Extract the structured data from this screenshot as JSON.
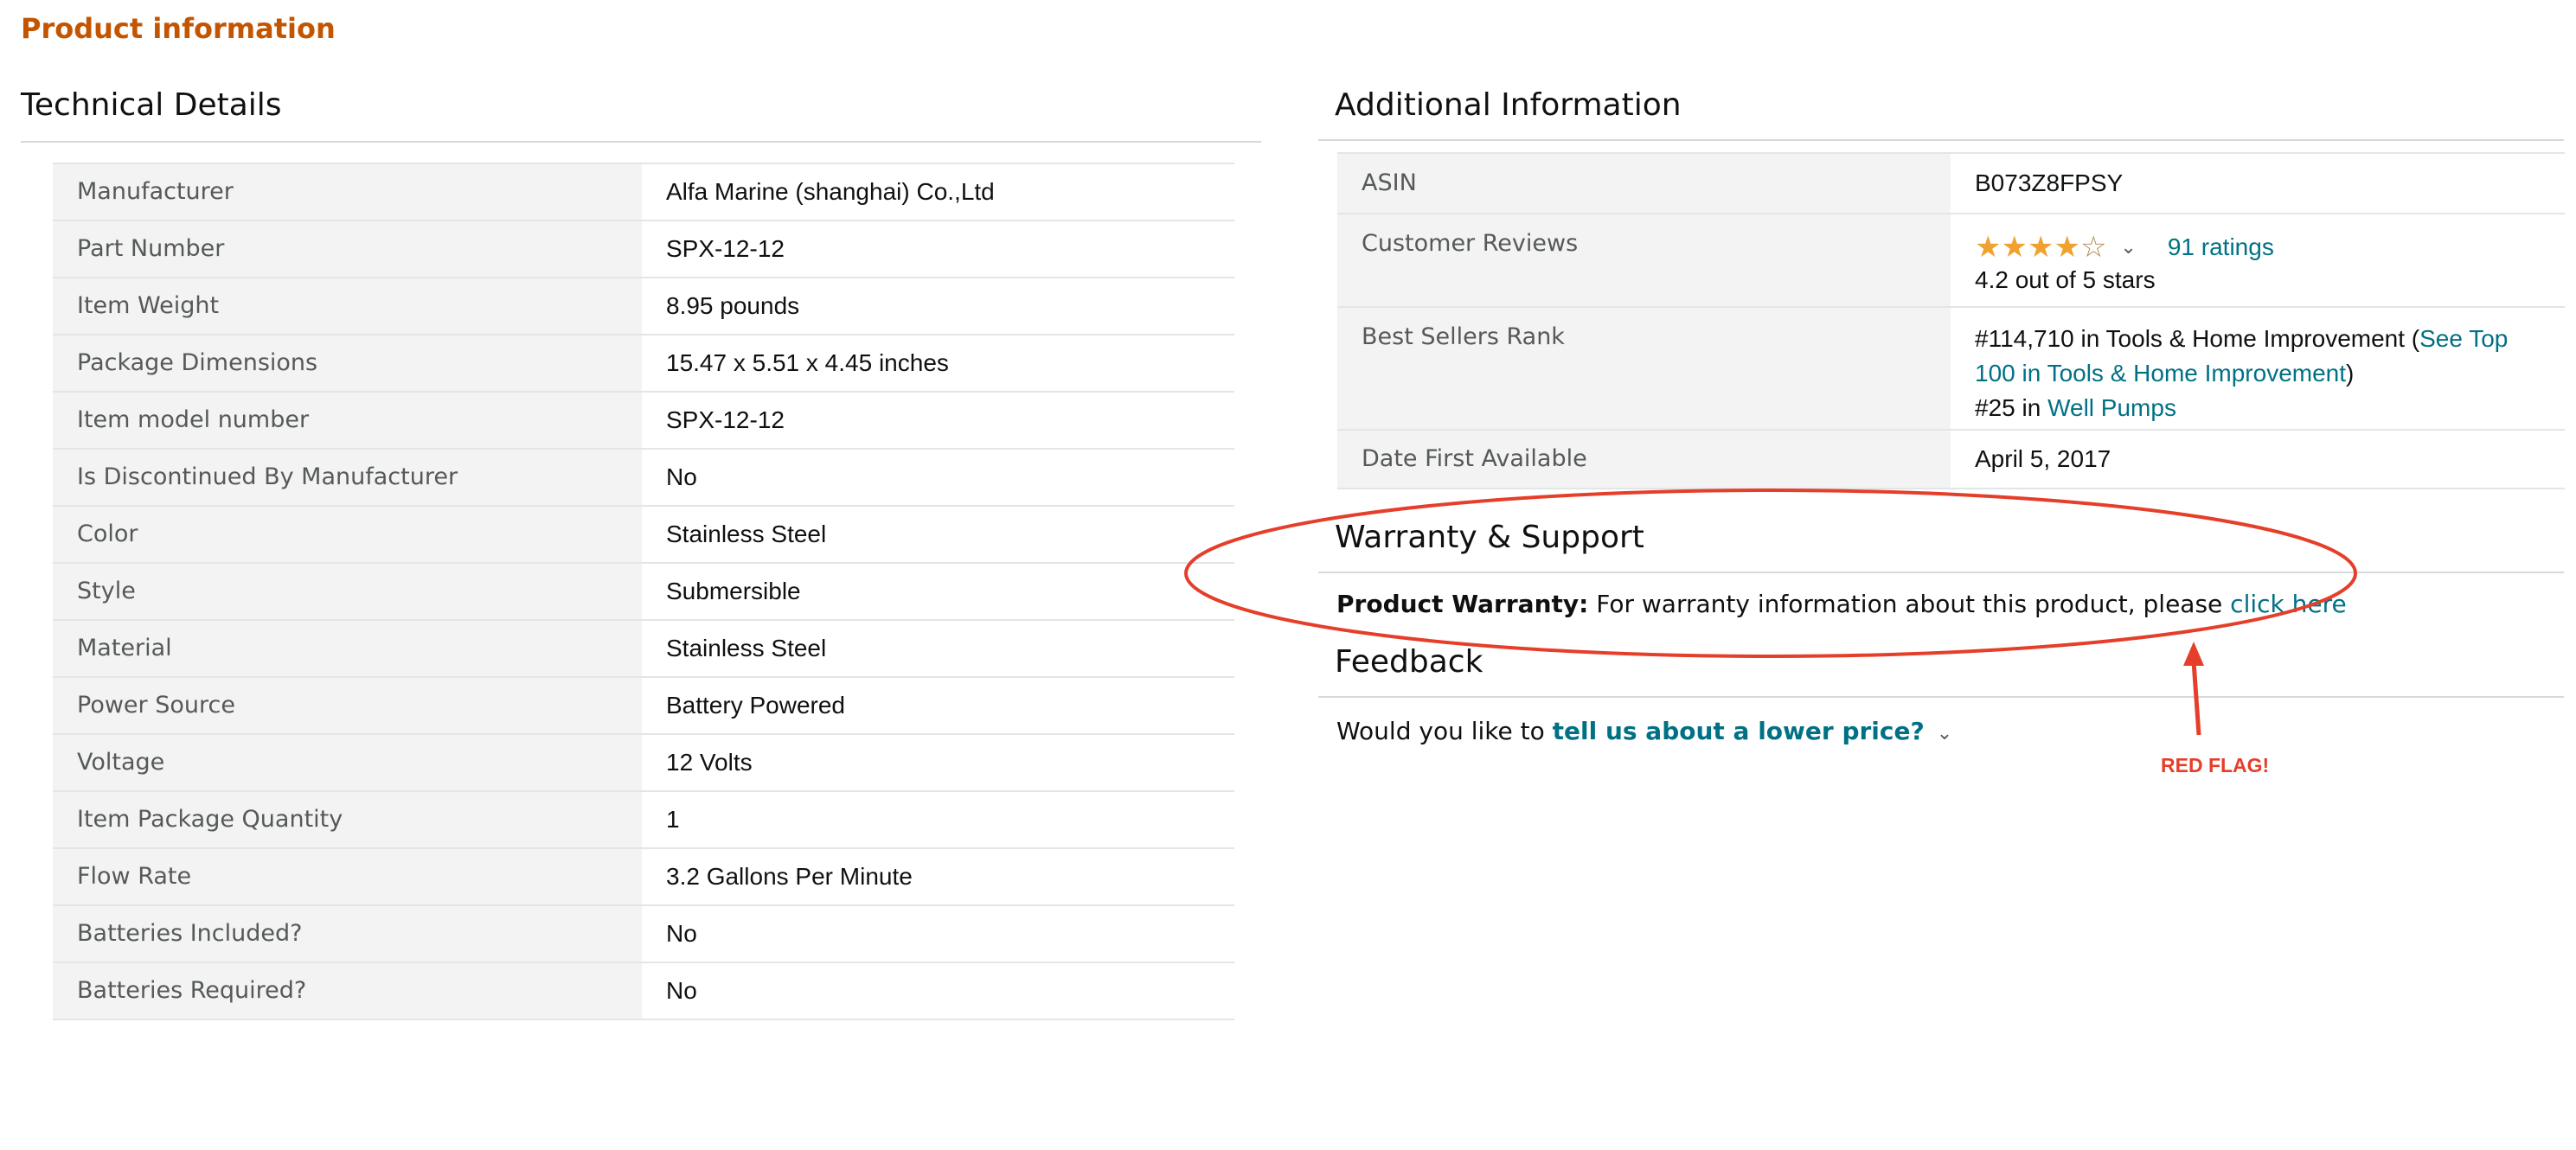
{
  "page_title": "Product information",
  "technical": {
    "heading": "Technical Details",
    "rows": [
      {
        "label": "Manufacturer",
        "value": "Alfa Marine (shanghai) Co.,Ltd"
      },
      {
        "label": "Part Number",
        "value": "SPX-12-12"
      },
      {
        "label": "Item Weight",
        "value": "8.95 pounds"
      },
      {
        "label": "Package Dimensions",
        "value": "15.47 x 5.51 x 4.45 inches"
      },
      {
        "label": "Item model number",
        "value": "SPX-12-12"
      },
      {
        "label": "Is Discontinued By Manufacturer",
        "value": "No"
      },
      {
        "label": "Color",
        "value": "Stainless Steel"
      },
      {
        "label": "Style",
        "value": "Submersible"
      },
      {
        "label": "Material",
        "value": "Stainless Steel"
      },
      {
        "label": "Power Source",
        "value": "Battery Powered"
      },
      {
        "label": "Voltage",
        "value": "12 Volts"
      },
      {
        "label": "Item Package Quantity",
        "value": "1"
      },
      {
        "label": "Flow Rate",
        "value": "3.2 Gallons Per Minute"
      },
      {
        "label": "Batteries Included?",
        "value": "No"
      },
      {
        "label": "Batteries Required?",
        "value": "No"
      }
    ]
  },
  "additional": {
    "heading": "Additional Information",
    "asin": {
      "label": "ASIN",
      "value": "B073Z8FPSY"
    },
    "reviews": {
      "label": "Customer Reviews",
      "rating": 4.2,
      "ratings_link": "91 ratings",
      "summary": "4.2 out of 5 stars"
    },
    "rank": {
      "label": "Best Sellers Rank",
      "line1_prefix": "#114,710 in Tools & Home Improvement (",
      "line1_link": "See Top 100 in Tools & Home Improvement",
      "line1_suffix": ")",
      "line2_prefix": "#25 in ",
      "line2_link": "Well Pumps"
    },
    "date": {
      "label": "Date First Available",
      "value": "April 5, 2017"
    }
  },
  "warranty": {
    "heading": "Warranty & Support",
    "label": "Product Warranty:",
    "text": " For warranty information about this product, please ",
    "link": "click here"
  },
  "feedback": {
    "heading": "Feedback",
    "prefix": "Would you like to ",
    "link": "tell us about a lower price?"
  },
  "annotation": {
    "text": "RED FLAG!",
    "color": "#e53e2a"
  },
  "colors": {
    "title": "#c45500",
    "link": "#007185",
    "star": "#f0a12e"
  }
}
